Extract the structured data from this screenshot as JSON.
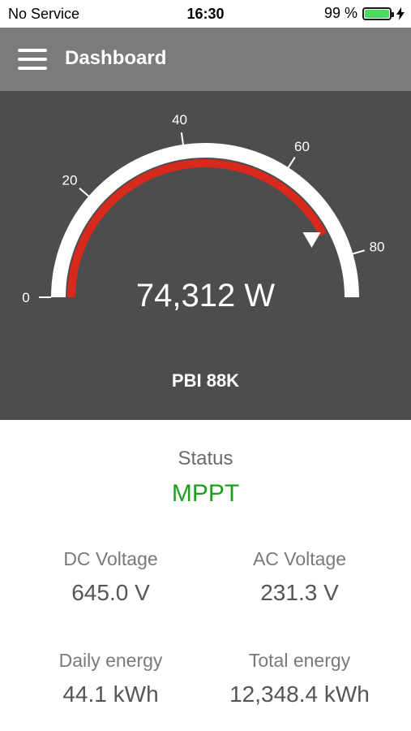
{
  "status_bar": {
    "carrier": "No Service",
    "time": "16:30",
    "battery_percent": "99 %",
    "battery_level": 0.99,
    "charging_icon": "bolt-icon"
  },
  "app_bar": {
    "title": "Dashboard",
    "menu_icon": "hamburger-menu-icon"
  },
  "gauge": {
    "min": 0,
    "max": 88,
    "value_kw": 74.312,
    "marker_kw": 74.3,
    "ticks": [
      "0",
      "20",
      "40",
      "60",
      "80"
    ],
    "value_text": "74,312 W",
    "device": "PBI 88K",
    "colors": {
      "track": "#ffffff",
      "fill": "#d8291d",
      "marker": "#ffffff",
      "panel": "#4d4d4d"
    }
  },
  "info": {
    "status_label": "Status",
    "status_value": "MPPT",
    "status_color": "#1f9d1f",
    "dc_voltage_label": "DC Voltage",
    "dc_voltage_value": "645.0 V",
    "ac_voltage_label": "AC Voltage",
    "ac_voltage_value": "231.3 V",
    "daily_energy_label": "Daily energy",
    "daily_energy_value": "44.1 kWh",
    "total_energy_label": "Total energy",
    "total_energy_value": "12,348.4 kWh"
  }
}
